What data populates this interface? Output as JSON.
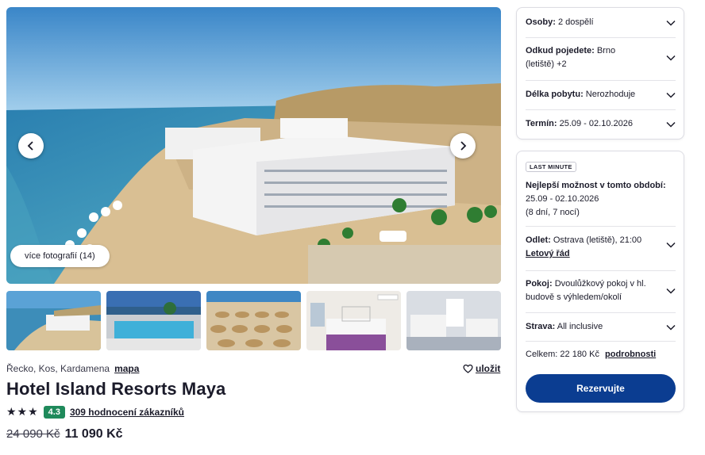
{
  "gallery": {
    "more_photos_label": "více fotografií (14)",
    "prev_icon": "chevron-left-icon",
    "next_icon": "chevron-right-icon"
  },
  "hotel": {
    "location": "Řecko, Kos, Kardamena",
    "map_link": "mapa",
    "save_label": "uložit",
    "name": "Hotel Island Resorts Maya",
    "stars": "★★★",
    "score": "4.3",
    "reviews": "309 hodnocení zákazníků",
    "old_price": "24 090 Kč",
    "new_price": "11 090 Kč"
  },
  "filters": {
    "persons_label": "Osoby:",
    "persons_value": "2 dospělí",
    "departure_label": "Odkud pojedete:",
    "departure_value": "Brno",
    "departure_value2": "(letiště) +2",
    "length_label": "Délka pobytu:",
    "length_value": "Nerozhoduje",
    "term_label": "Termín:",
    "term_value": "25.09 - 02.10.2026"
  },
  "offer": {
    "badge": "LAST MINUTE",
    "best_title": "Nejlepší možnost v tomto období:",
    "best_dates": "25.09 - 02.10.2026",
    "best_duration": "(8 dní, 7 nocí)",
    "flight_label": "Odlet:",
    "flight_value": "Ostrava (letiště), 21:00",
    "timetable_link": "Letový řád",
    "room_label": "Pokoj:",
    "room_value": "Dvoulůžkový pokoj v hl.",
    "room_value2": "budově s výhledem/okolí",
    "board_label": "Strava:",
    "board_value": "All inclusive",
    "total_label": "Celkem:",
    "total_value": "22 180 Kč",
    "details_link": "podrobnosti",
    "reserve_label": "Rezervujte"
  },
  "colors": {
    "accent": "#0b3d91",
    "score_bg": "#1f8a5b"
  }
}
